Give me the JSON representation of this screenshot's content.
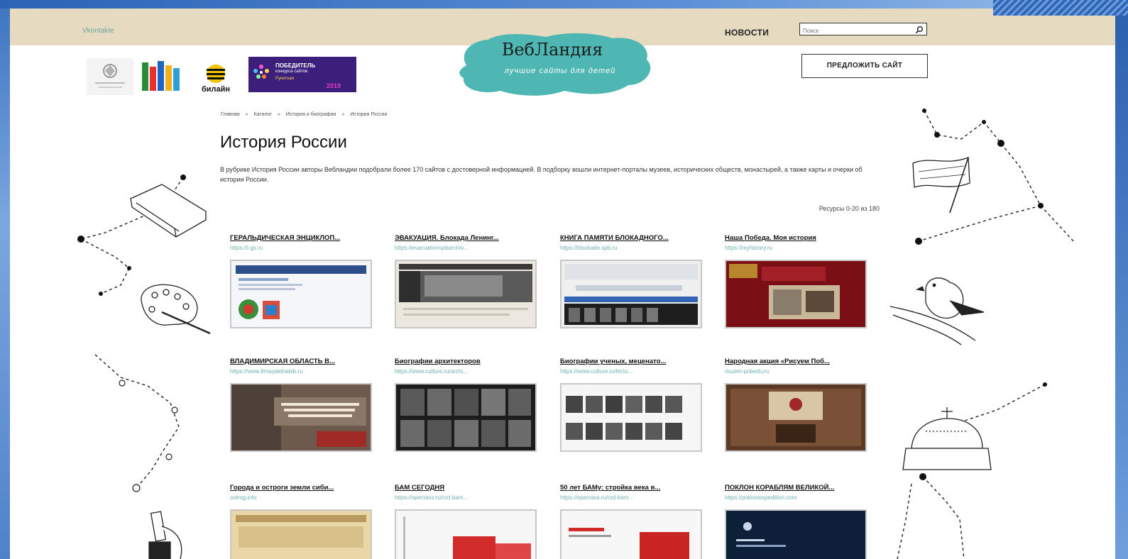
{
  "header": {
    "small_link": "Vkontakte",
    "news_label": "НОВОСТИ",
    "search_placeholder": "Поиск",
    "suggest_button": "ПРЕДЛОЖИТЬ САЙТ"
  },
  "logo": {
    "title": "ВебЛандия",
    "subtitle": "лучшие сайты для детей"
  },
  "partners": {
    "beeline": "билайн",
    "award": {
      "line1": "ПОБЕДИТЕЛЬ",
      "line2": "конкурса сайтов",
      "line3": "Рунетная",
      "line4": "2019"
    }
  },
  "breadcrumb": [
    "Главная",
    "»",
    "Каталог",
    "»",
    "История и биографии",
    "»",
    "История России"
  ],
  "page": {
    "title": "История России",
    "intro": "В рубрике История России авторы Вебландии подобрали более 170 сайтов с достоверной информацией. В подборку вошли интернет-порталы музеев, исторических обществ, монастырей, а также карты и очерки об истории России.",
    "resources": "Ресурсы 0-20 из 180"
  },
  "cards": [
    {
      "title": "ГЕРАЛЬДИЧЕСКАЯ ЭНЦИКЛОП...",
      "url": "https://i-gs.ru"
    },
    {
      "title": "ЭВАКУАЦИЯ. Блокада Ленинг...",
      "url": "https://evacuationspbarchiv..."
    },
    {
      "title": "КНИГА ПАМЯТИ БЛОКАДНОГО...",
      "url": "https://blockade.spb.ru"
    },
    {
      "title": "Наша Победа. Моя история",
      "url": "https://myhistory.ru"
    },
    {
      "title": "ВЛАДИМИРСКАЯ ОБЛАСТЬ В...",
      "url": "https://www.9maydetnebib.ru"
    },
    {
      "title": "Биографии архитекторов",
      "url": "https://www.culture.ru/archi..."
    },
    {
      "title": "Биографии ученых, меценато...",
      "url": "https://www.culture.ru/lectu..."
    },
    {
      "title": "Народная акция «Рисуем Поб...",
      "url": "risuem-pobedu.ru"
    },
    {
      "title": "Города и остроги земли сиби...",
      "url": "ostrog.info"
    },
    {
      "title": "БАМ СЕГОДНЯ",
      "url": "https://spectass.ru/rzd-bam..."
    },
    {
      "title": "50 лет БАМу: стройка века в...",
      "url": "https://spectass.ru/rzd-bam..."
    },
    {
      "title": "ПОКЛОН КОРАБЛЯМ ВЕЛИКОЙ...",
      "url": "https://poklonexpedition.com"
    }
  ],
  "colors": {
    "topbar": "#e6dbc0",
    "logo_blob": "#4fb7b3",
    "url_text": "#6cb3b0",
    "award_bg": "#3b1f7a"
  }
}
